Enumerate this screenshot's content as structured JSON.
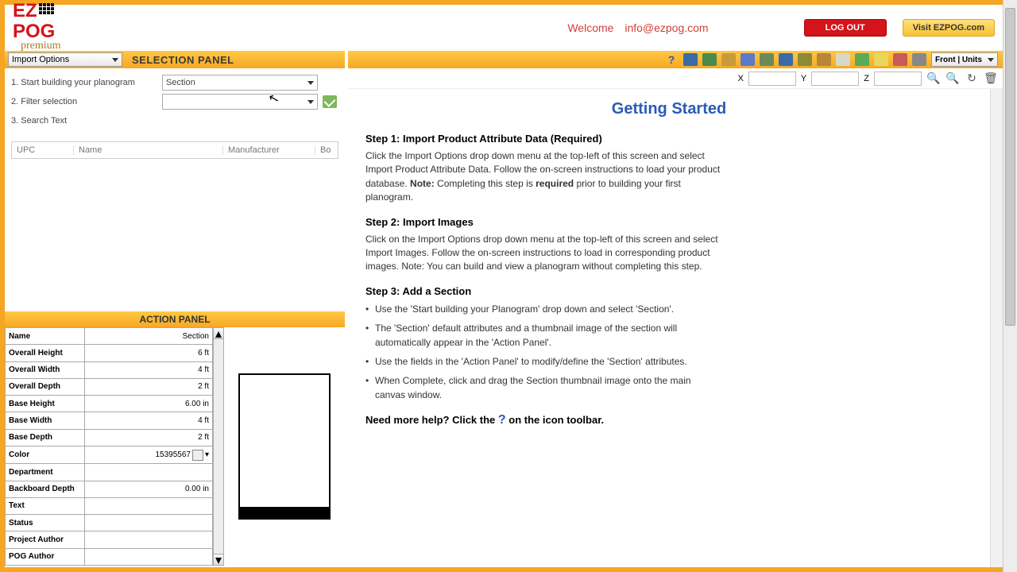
{
  "header": {
    "welcome": "Welcome",
    "email": "info@ezpog.com",
    "logout": "LOG OUT",
    "visit": "Visit EZPOG.com"
  },
  "selection": {
    "panel_title": "SELECTION PANEL",
    "import_dd": "Import Options",
    "row1": "1. Start building your planogram",
    "row1_val": "Section",
    "row2": "2. Filter selection",
    "row3": "3. Search Text",
    "cols": {
      "upc": "UPC",
      "name": "Name",
      "mfr": "Manufacturer",
      "bo": "Bo"
    }
  },
  "action": {
    "title": "ACTION PANEL",
    "rows": [
      {
        "k": "Name",
        "v": "Section"
      },
      {
        "k": "Overall Height",
        "v": "6 ft"
      },
      {
        "k": "Overall Width",
        "v": "4 ft"
      },
      {
        "k": "Overall Depth",
        "v": "2 ft"
      },
      {
        "k": "Base Height",
        "v": "6.00 in"
      },
      {
        "k": "Base Width",
        "v": "4 ft"
      },
      {
        "k": "Base Depth",
        "v": "2 ft"
      },
      {
        "k": "Color",
        "v": "15395567"
      },
      {
        "k": "Department",
        "v": ""
      },
      {
        "k": "Backboard Depth",
        "v": "0.00 in"
      },
      {
        "k": "Text",
        "v": ""
      },
      {
        "k": "Status",
        "v": ""
      },
      {
        "k": "Project Author",
        "v": ""
      },
      {
        "k": "POG Author",
        "v": ""
      }
    ]
  },
  "coords": {
    "x": "X",
    "y": "Y",
    "z": "Z"
  },
  "toolbar": {
    "view": "Front | Units"
  },
  "content": {
    "title": "Getting Started",
    "s1h": "Step 1:  Import Product Attribute Data (Required)",
    "s1p_a": "Click the Import Options drop down menu at the top-left of this screen and select Import Product Attribute Data.  Follow the on-screen instructions to load your product database.  ",
    "s1p_note": "Note:",
    "s1p_b": " Completing this step is ",
    "s1p_req": "required",
    "s1p_c": " prior to building your first planogram.",
    "s2h": "Step 2:  Import Images",
    "s2p": "Click on the Import Options drop down menu at the top-left of this screen and select Import Images.  Follow the on-screen instructions to load in corresponding product images.  Note:  You can build and view a planogram without completing this step.",
    "s3h": "Step 3: Add a Section",
    "s3b1": "Use the 'Start building your Planogram' drop down and select 'Section'.",
    "s3b2": "The 'Section' default attributes and a thumbnail image of the section will automatically appear in the 'Action Panel'.",
    "s3b3": "Use the fields in the 'Action Panel' to modify/define the 'Section' attributes.",
    "s3b4": "When Complete, click and drag the Section thumbnail image onto the main canvas window.",
    "help_a": "Need more help? Click the ",
    "help_q": "?",
    "help_b": " on the icon toolbar."
  }
}
